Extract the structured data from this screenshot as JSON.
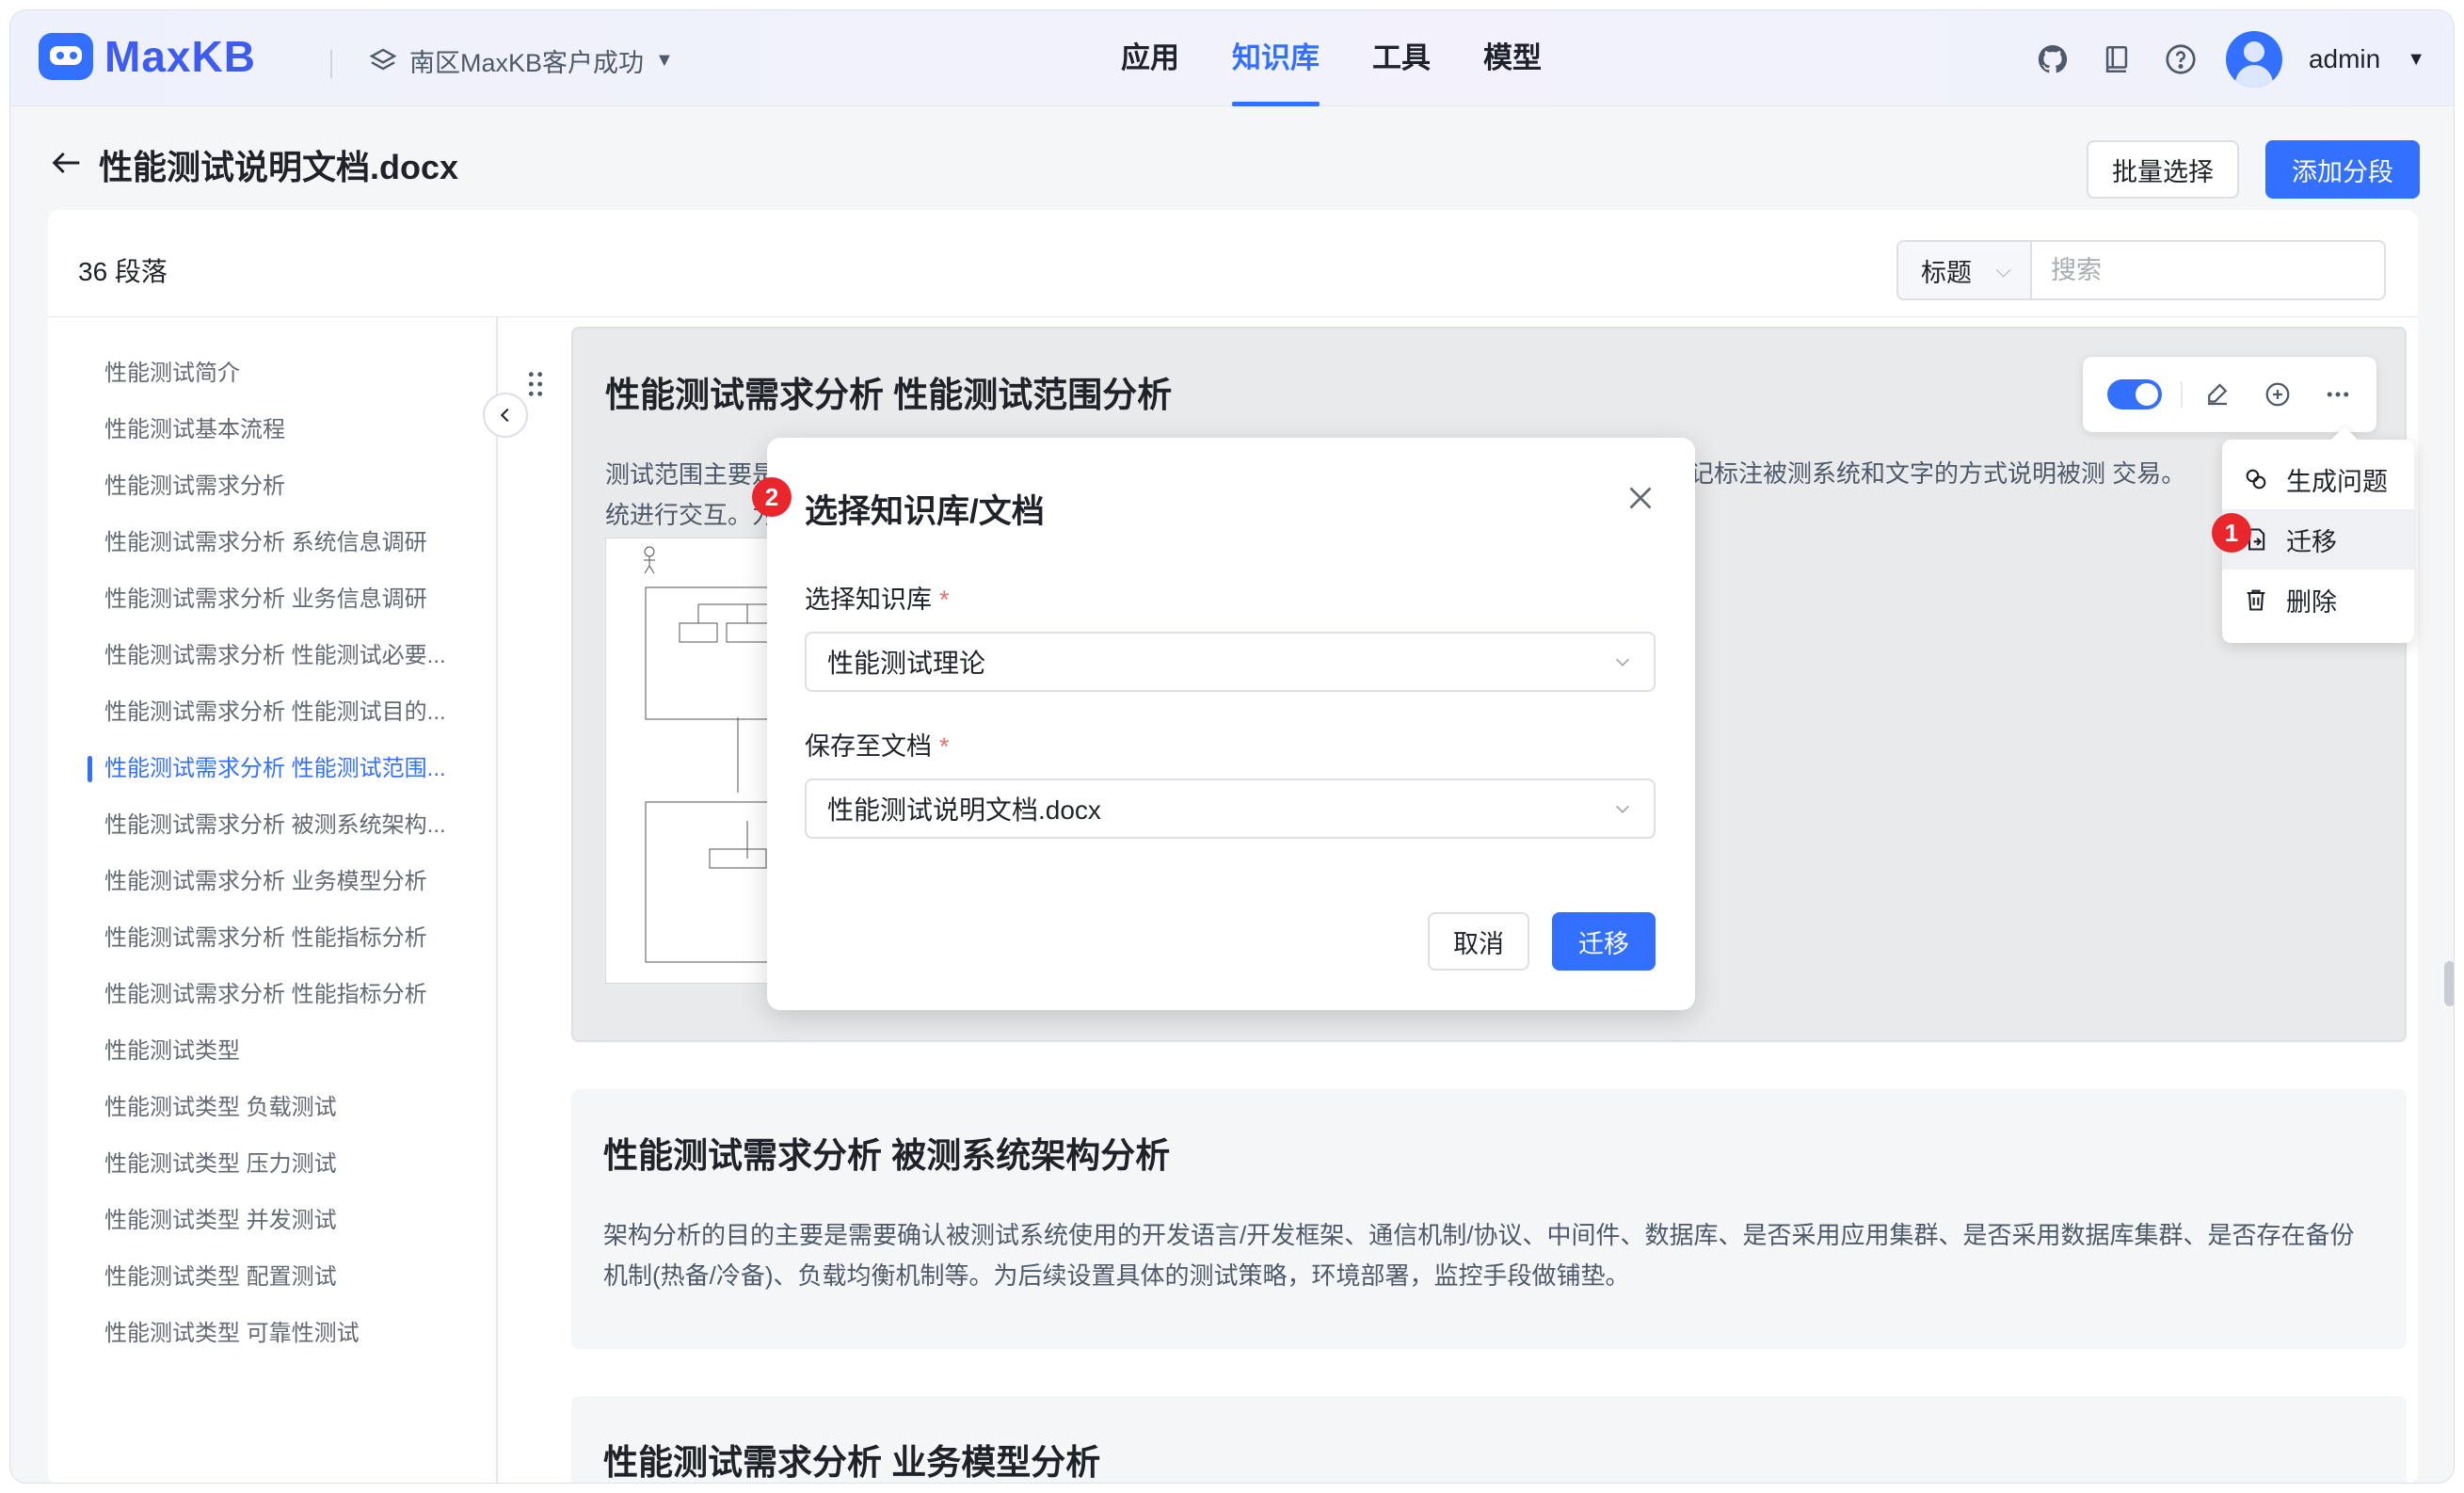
{
  "header": {
    "logo_text": "MaxKB",
    "workspace": "南区MaxKB客户成功",
    "nav": [
      "应用",
      "知识库",
      "工具",
      "模型"
    ],
    "active_nav": "知识库",
    "user": "admin"
  },
  "page": {
    "title": "性能测试说明文档.docx",
    "batch_select": "批量选择",
    "add_segment": "添加分段",
    "paragraph_count": "36 段落",
    "search_type": "标题",
    "search_placeholder": "搜索"
  },
  "sidebar": {
    "items": [
      "性能测试简介",
      "性能测试基本流程",
      "性能测试需求分析",
      "性能测试需求分析 系统信息调研",
      "性能测试需求分析 业务信息调研",
      "性能测试需求分析 性能测试必要...",
      "性能测试需求分析 性能测试目的...",
      "性能测试需求分析 性能测试范围...",
      "性能测试需求分析 被测系统架构...",
      "性能测试需求分析 业务模型分析",
      "性能测试需求分析 性能指标分析",
      "性能测试需求分析 性能指标分析",
      "性能测试类型",
      "性能测试类型 负载测试",
      "性能测试类型 压力测试",
      "性能测试类型 并发测试",
      "性能测试类型 配置测试",
      "性能测试类型 可靠性测试"
    ],
    "active_index": 7
  },
  "blocks": [
    {
      "title": "性能测试需求分析 性能测试范围分析",
      "text_left_line1": "测试范围主要是",
      "text_left_line2": "统进行交互。为",
      "text_right": "标记标注被测系统和文字的方式说明被测 交易。"
    },
    {
      "title": "性能测试需求分析 被测系统架构分析",
      "text": "架构分析的目的主要是需要确认被测试系统使用的开发语言/开发框架、通信机制/协议、中间件、数据库、是否采用应用集群、是否采用数据库集群、是否存在备份机制(热备/冷备)、负载均衡机制等。为后续设置具体的测试策略，环境部署，监控手段做铺垫。"
    },
    {
      "title": "性能测试需求分析 业务模型分析"
    }
  ],
  "dropdown": {
    "items": [
      "生成问题",
      "迁移",
      "删除"
    ]
  },
  "dialog": {
    "title": "选择知识库/文档",
    "kb_label": "选择知识库",
    "kb_value": "性能测试理论",
    "doc_label": "保存至文档",
    "doc_value": "性能测试说明文档.docx",
    "cancel": "取消",
    "confirm": "迁移"
  },
  "badges": [
    "1",
    "2"
  ],
  "colors": {
    "accent": "#3370ff",
    "badge": "#e8262c"
  }
}
